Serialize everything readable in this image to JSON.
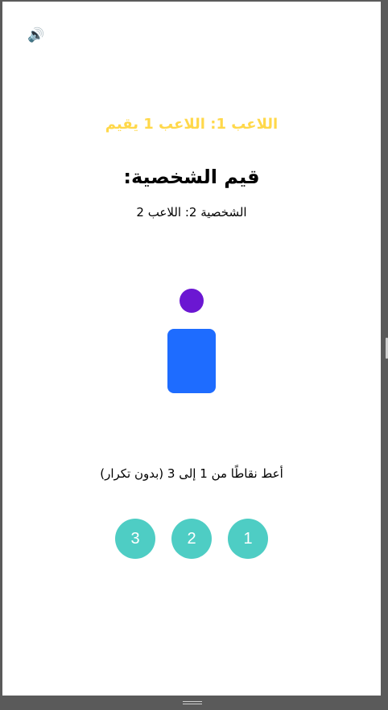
{
  "game": {
    "turn_banner": "اللاعب 1: اللاعب 1 يقيم",
    "rate_heading": "قيم الشخصية:",
    "character_name": "الشخصية 2: اللاعب 2",
    "instructions": "أعط نقاطًا من 1 إلى 3 (بدون تكرار)",
    "scores": [
      "1",
      "2",
      "3"
    ],
    "sound_icon": "🔊"
  },
  "colors": {
    "turn_banner": "#ffd84a",
    "character_head": "#6b17d2",
    "character_body": "#1e6cff",
    "score_button": "#4ecdc4"
  },
  "icons": {
    "sound": "speaker-icon"
  }
}
